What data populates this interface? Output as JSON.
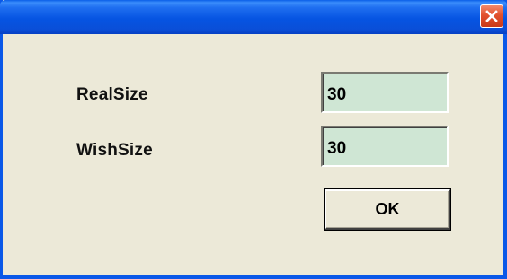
{
  "window": {
    "title": "",
    "close_icon": "close-icon"
  },
  "form": {
    "real_size": {
      "label": "RealSize",
      "value": "30"
    },
    "wish_size": {
      "label": "WishSize",
      "value": "30"
    },
    "ok_label": "OK"
  },
  "colors": {
    "titlebar": "#0a58e8",
    "dialog_background": "#ece9d8",
    "field_background": "#cfe6d4",
    "close_button": "#e2512c"
  }
}
